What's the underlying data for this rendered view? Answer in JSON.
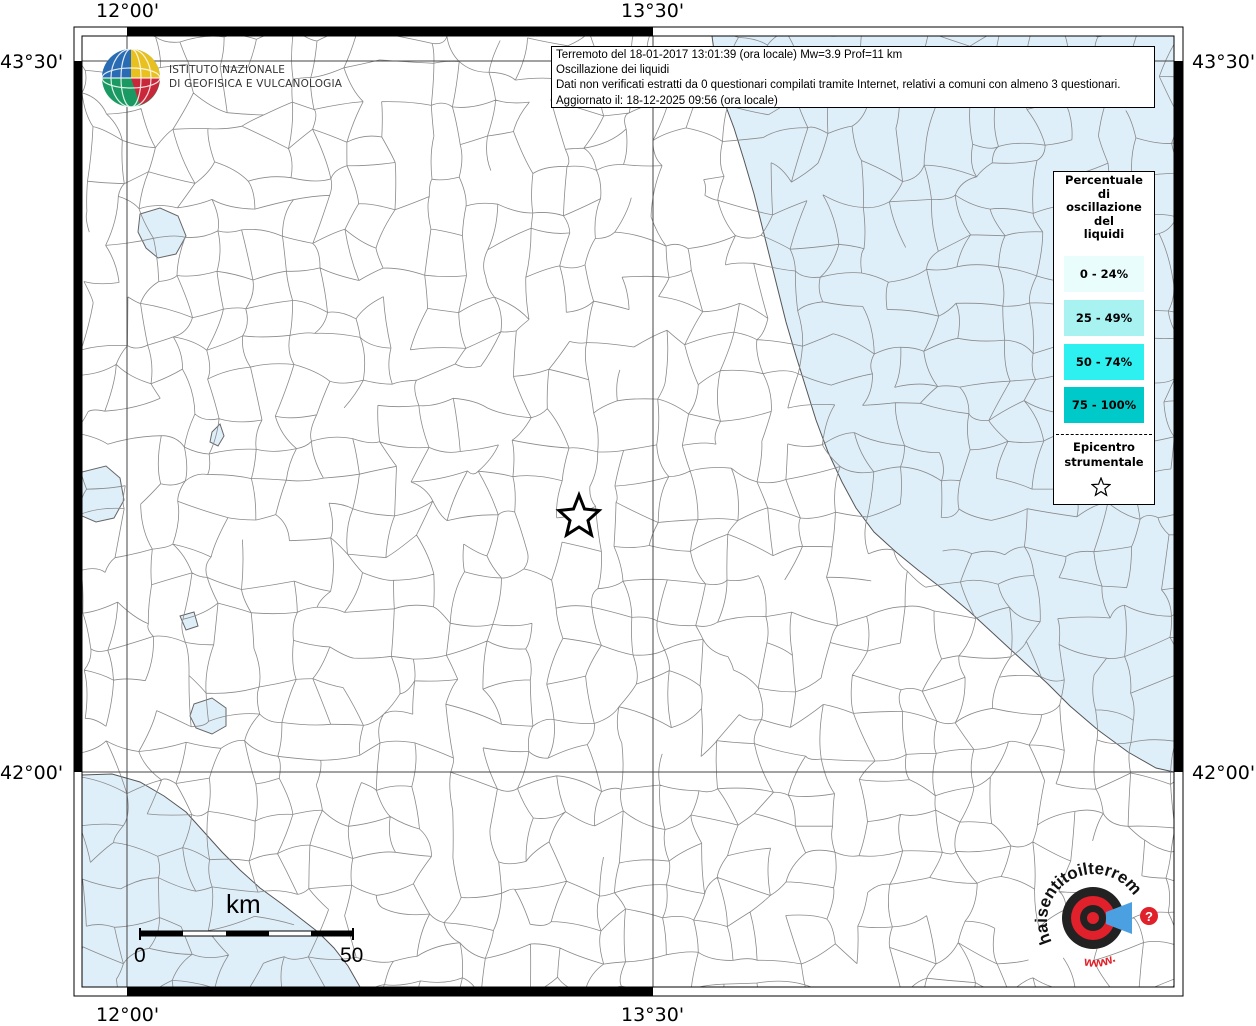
{
  "colors": {
    "sea": "#dfeffa",
    "lake": "#dfeffa",
    "border": "#8a8a8a",
    "legend_0_24": "#e9fdfd",
    "legend_25_49": "#a8f2f2",
    "legend_50_74": "#2ff0f0",
    "legend_75_100": "#00c9c9"
  },
  "map": {
    "coords": {
      "top_left_lon": "12°00'",
      "top_mid_lon": "13°30'",
      "bottom_left_lon": "12°00'",
      "bottom_mid_lon": "13°30'",
      "left_top_lat": "43°30'",
      "left_bottom_lat": "42°00'",
      "right_top_lat": "43°30'",
      "right_bottom_lat": "42°00'"
    },
    "info": {
      "line1": "Terremoto del 18-01-2017 13:01:39 (ora locale) Mw=3.9 Prof=11 km",
      "line2": "Oscillazione dei liquidi",
      "line3": "Dati non verificati estratti da 0 questionari compilati tramite Internet, relativi a comuni con almeno 3 questionari.",
      "line4": "Aggiornato il: 18-12-2025 09:56 (ora locale)"
    },
    "logo": {
      "line1": "ISTITUTO NAZIONALE",
      "line2": "DI GEOFISICA E VULCANOLOGIA"
    },
    "legend": {
      "title_lines": [
        "Percentuale",
        "di",
        "oscillazione",
        "del",
        "liquidi"
      ],
      "classes": [
        "0 - 24%",
        "25 - 49%",
        "50 - 74%",
        "75 - 100%"
      ],
      "epicenter_lines": [
        "Epicentro",
        "strumentale"
      ]
    },
    "scale": {
      "unit": "km",
      "start": "0",
      "end": "50"
    },
    "brand": {
      "text": "haisentitoilterremoto.it",
      "prefix": "www.",
      "badge": "?"
    }
  }
}
